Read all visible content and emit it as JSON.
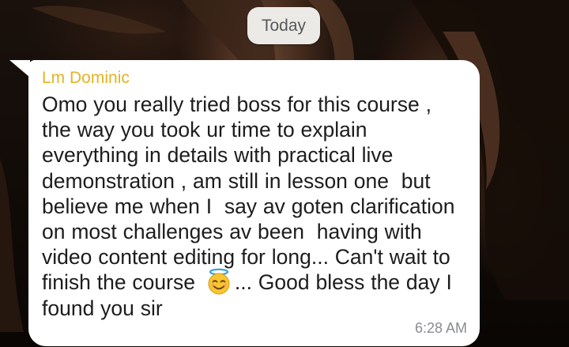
{
  "chat": {
    "date_label": "Today"
  },
  "message": {
    "sender": "Lm Dominic",
    "text_before_emoji": "Omo you really tried boss for this course ,\nthe way you took ur time to explain\neverything in details with practical live\ndemonstration , am still in lesson one  but\nbelieve me when I  say av goten clarification\non most challenges av been  having with\nvideo content editing for long... Can't wait to\nfinish the course ",
    "emoji": "smiling-face-with-halo-emoji",
    "text_after_emoji": "... Good bless the day I\nfound you sir",
    "time": "6:28 AM"
  },
  "colors": {
    "sender_name": "#e3b325",
    "bubble": "#ffffff",
    "date_chip": "#eceae6",
    "message_text": "#1d1d1d",
    "timestamp": "#888c8f"
  }
}
